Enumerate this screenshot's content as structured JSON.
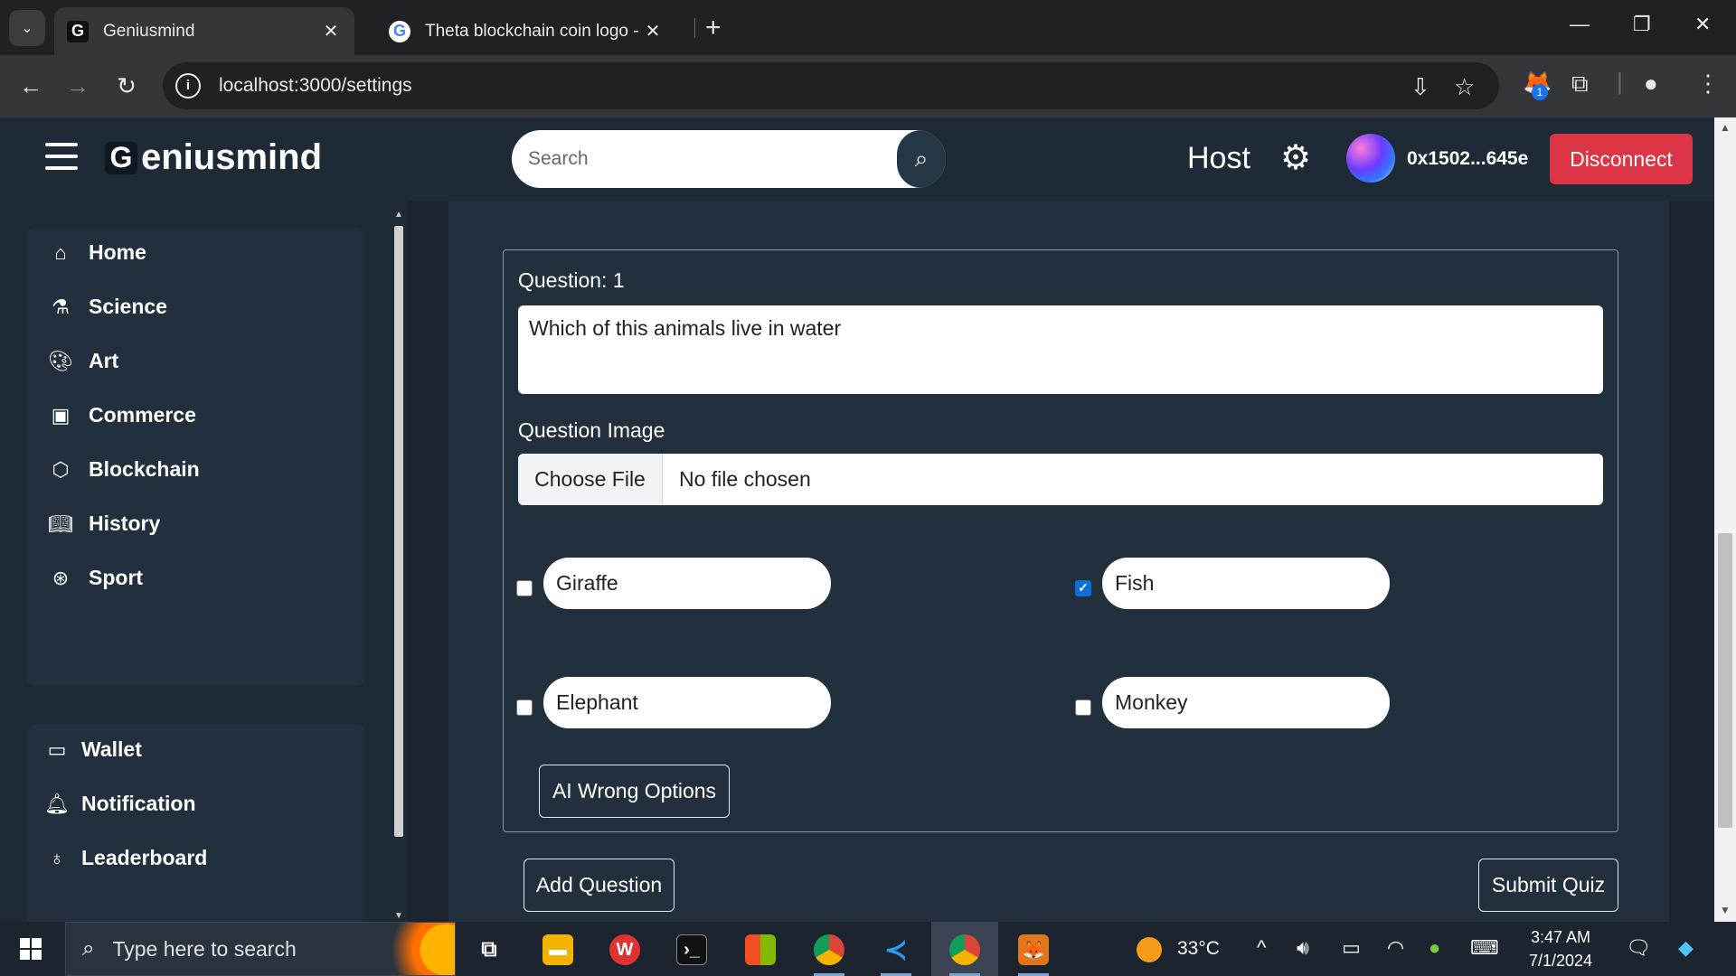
{
  "browser": {
    "tabs": [
      {
        "title": "Geniusmind",
        "favicon": "G",
        "active": true
      },
      {
        "title": "Theta blockchain coin logo - Go",
        "favicon": "G",
        "active": false
      }
    ],
    "url": "localhost:3000/settings",
    "extension_badge": "1"
  },
  "header": {
    "logo_mark": "G",
    "logo_text": "eniusmind",
    "search_placeholder": "Search",
    "role": "Host",
    "wallet_address": "0x1502...645e",
    "disconnect_label": "Disconnect"
  },
  "sidebar": {
    "categories": [
      {
        "label": "Home",
        "icon": "home-icon"
      },
      {
        "label": "Science",
        "icon": "science-icon"
      },
      {
        "label": "Art",
        "icon": "palette-icon"
      },
      {
        "label": "Commerce",
        "icon": "money-icon"
      },
      {
        "label": "Blockchain",
        "icon": "blocks-icon"
      },
      {
        "label": "History",
        "icon": "book-icon"
      },
      {
        "label": "Sport",
        "icon": "ball-icon"
      }
    ],
    "account": [
      {
        "label": "Wallet",
        "icon": "wallet-icon"
      },
      {
        "label": "Notification",
        "icon": "bell-icon"
      },
      {
        "label": "Leaderboard",
        "icon": "award-icon"
      }
    ]
  },
  "quiz": {
    "question_label": "Question: 1",
    "question_text": "Which of this animals live in water",
    "image_label": "Question Image",
    "choose_file_label": "Choose File",
    "file_status": "No file chosen",
    "options": [
      {
        "text": "Giraffe",
        "checked": false
      },
      {
        "text": "Fish",
        "checked": true
      },
      {
        "text": "Elephant",
        "checked": false
      },
      {
        "text": "Monkey",
        "checked": false
      }
    ],
    "ai_button": "AI Wrong Options",
    "add_question": "Add Question",
    "submit_quiz": "Submit Quiz"
  },
  "taskbar": {
    "search_placeholder": "Type here to search",
    "temperature": "33°C",
    "time": "3:47 AM",
    "date": "7/1/2024"
  },
  "colors": {
    "disconnect": "#dc3545",
    "header_bg": "#1e2a35",
    "checkbox_checked": "#0b6fd6"
  }
}
